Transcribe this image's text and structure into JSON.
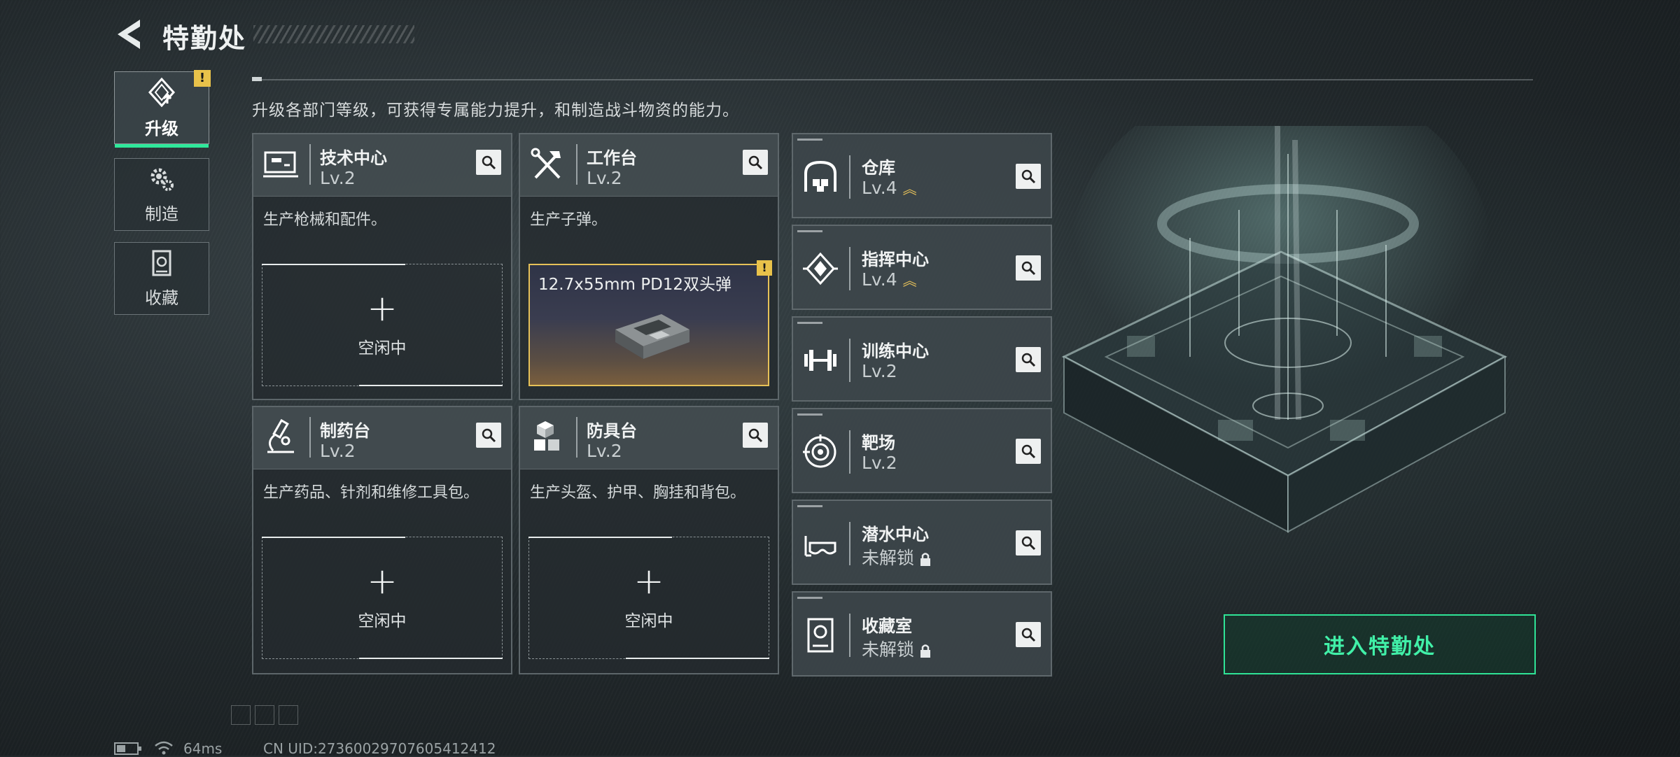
{
  "header": {
    "title": "特勤处"
  },
  "nav": [
    {
      "label": "升级",
      "icon": "upgrade-icon",
      "active": true,
      "alert": "!"
    },
    {
      "label": "制造",
      "icon": "gears-icon",
      "active": false
    },
    {
      "label": "收藏",
      "icon": "collection-icon",
      "active": false
    }
  ],
  "description": "升级各部门等级，可获得专属能力提升，和制造战斗物资的能力。",
  "modules": [
    {
      "name": "技术中心",
      "level": "Lv.2",
      "desc": "生产枪械和配件。",
      "slot_label": "空闲中",
      "icon": "monitor-icon"
    },
    {
      "name": "工作台",
      "level": "Lv.2",
      "desc": "生产子弹。",
      "craft_item": "12.7x55mm PD12双头弹",
      "alert": "!",
      "icon": "tools-icon"
    },
    {
      "name": "制药台",
      "level": "Lv.2",
      "desc": "生产药品、针剂和维修工具包。",
      "slot_label": "空闲中",
      "icon": "microscope-icon"
    },
    {
      "name": "防具台",
      "level": "Lv.2",
      "desc": "生产头盔、护甲、胸挂和背包。",
      "slot_label": "空闲中",
      "icon": "boxes-icon"
    }
  ],
  "facilities": [
    {
      "name": "仓库",
      "level": "Lv.4",
      "upgradable": true,
      "icon": "warehouse-icon"
    },
    {
      "name": "指挥中心",
      "level": "Lv.4",
      "upgradable": true,
      "icon": "chip-icon"
    },
    {
      "name": "训练中心",
      "level": "Lv.2",
      "upgradable": false,
      "icon": "dumbbell-icon"
    },
    {
      "name": "靶场",
      "level": "Lv.2",
      "upgradable": false,
      "icon": "target-icon"
    },
    {
      "name": "潜水中心",
      "level": "未解锁",
      "locked": true,
      "icon": "diving-mask-icon"
    },
    {
      "name": "收藏室",
      "level": "未解锁",
      "locked": true,
      "icon": "display-case-icon"
    }
  ],
  "enter_button": "进入特勤处",
  "status": {
    "ping": "64ms",
    "uid": "CN UID:27360029707605412412"
  },
  "colors": {
    "accent": "#2ee89a",
    "alert": "#e9c24a",
    "craft_border": "#e6c158"
  }
}
